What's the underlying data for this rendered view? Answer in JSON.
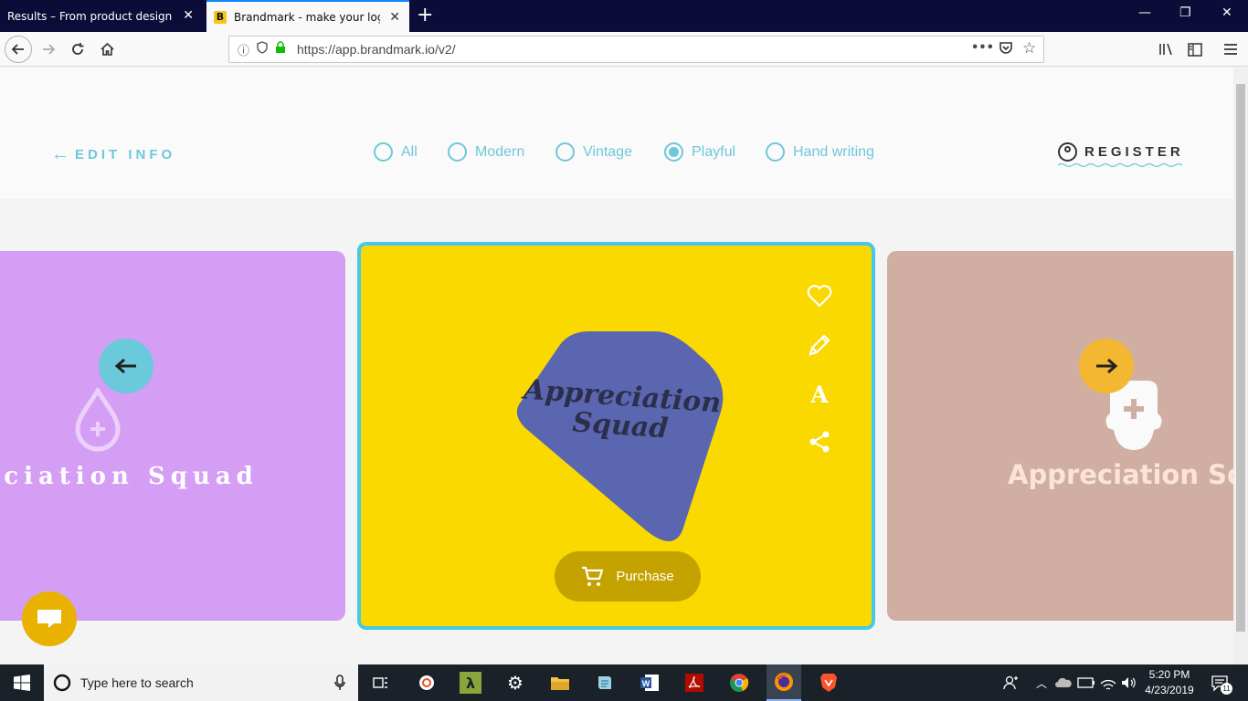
{
  "browser": {
    "tabs": [
      {
        "title": "Results – From product design to d"
      },
      {
        "title": "Brandmark - make your logo in"
      }
    ],
    "url": "https://app.brandmark.io/v2/"
  },
  "header": {
    "edit_info": "EDIT INFO",
    "style_options": [
      {
        "label": "All",
        "checked": false
      },
      {
        "label": "Modern",
        "checked": false
      },
      {
        "label": "Vintage",
        "checked": false
      },
      {
        "label": "Playful",
        "checked": true
      },
      {
        "label": "Hand writing",
        "checked": false
      }
    ],
    "register": "REGISTER"
  },
  "carousel": {
    "left_card": {
      "text": "reciation Squad",
      "color": "#d59ef5"
    },
    "center_card": {
      "logo_line1": "Appreciation",
      "logo_line2": "Squad",
      "color": "#fad900",
      "shape_color": "#5b66b0"
    },
    "right_card": {
      "text": "Appreciation Squa",
      "color": "#d0aea2"
    },
    "purchase_label": "Purchase"
  },
  "taskbar": {
    "search_placeholder": "Type here to search",
    "time": "5:20 PM",
    "date": "4/23/2019",
    "notification_count": "11"
  }
}
